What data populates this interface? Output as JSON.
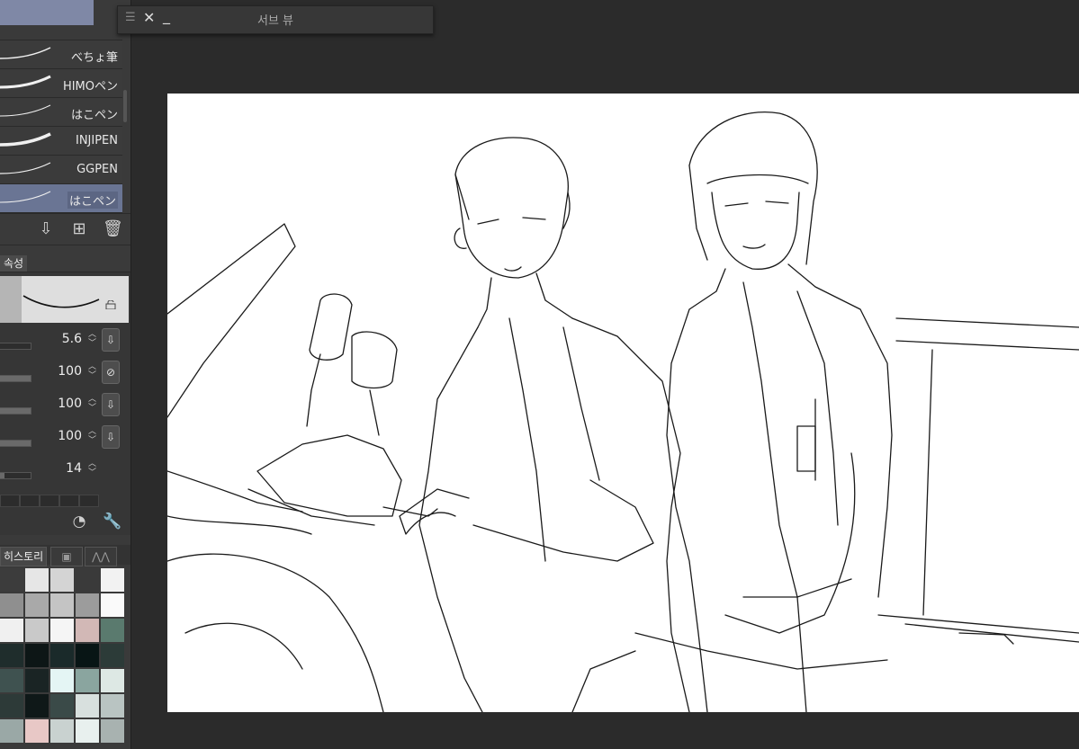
{
  "subview": {
    "title": "서브 뷰"
  },
  "brushes": {
    "items": [
      {
        "label": "べちょ筆",
        "selected": false
      },
      {
        "label": "HIMOペン",
        "selected": false
      },
      {
        "label": "はこペン",
        "selected": false
      },
      {
        "label": "INJIPEN",
        "selected": false
      },
      {
        "label": "GGPEN",
        "selected": false
      },
      {
        "label": "はこペン",
        "selected": true
      }
    ]
  },
  "properties": {
    "tab_label": "속성",
    "params": [
      {
        "value": "5.6",
        "icon": "download-icon",
        "fill": 0.0
      },
      {
        "value": "100",
        "icon": "no-pressure-icon",
        "fill": 1.0
      },
      {
        "value": "100",
        "icon": "download-icon",
        "fill": 1.0
      },
      {
        "value": "100",
        "icon": "download-icon",
        "fill": 1.0
      },
      {
        "value": "14",
        "icon": "",
        "fill": 0.14
      }
    ]
  },
  "bottom_tabs": {
    "history_label": "히스토리"
  },
  "colors": {
    "accent": "#6a7594",
    "swatches": [
      [
        "#3c3c3c",
        "#e6e6e6",
        "#d4d4d4",
        "#3a3a3a",
        "#f2f2f2"
      ],
      [
        "#8f8f8f",
        "#a9a9a9",
        "#c4c4c4",
        "#9c9c9c",
        "#fafafa"
      ],
      [
        "#f0f0f0",
        "#c9c9c9",
        "#f5f5f5",
        "#d2b8b6",
        "#5a7a6e"
      ],
      [
        "#1f2d2c",
        "#0d1616",
        "#1a2a2a",
        "#081515",
        "#2c3b38"
      ],
      [
        "#3f5250",
        "#1a2424",
        "#e4f5f4",
        "#8aa59f",
        "#dde8e4"
      ],
      [
        "#2d3a38",
        "#0f1818",
        "#3a4a48",
        "#d8e0de",
        "#b9c4c2"
      ],
      [
        "#9aa8a6",
        "#e8c8c6",
        "#c9d2d0",
        "#e8f0ee",
        "#a8b2b0"
      ]
    ]
  }
}
